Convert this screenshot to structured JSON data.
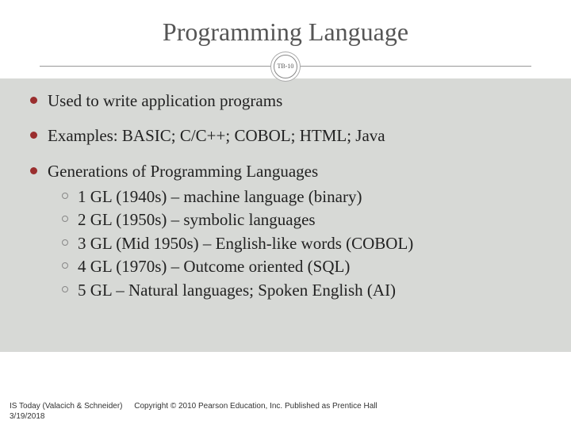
{
  "title": "Programming Language",
  "badge": "TB-10",
  "bullets": [
    {
      "text": "Used to write application programs"
    },
    {
      "text": "Examples: BASIC; C/C++; COBOL; HTML; Java"
    },
    {
      "text": "Generations of Programming Languages",
      "sub": [
        "1 GL (1940s) – machine language (binary)",
        "2 GL (1950s) – symbolic languages",
        "3 GL (Mid 1950s) – English-like words (COBOL)",
        "4 GL (1970s) – Outcome oriented (SQL)",
        "5 GL – Natural languages; Spoken English (AI)"
      ]
    }
  ],
  "footer": {
    "source": "IS Today (Valacich & Schneider)",
    "copyright": "Copyright © 2010 Pearson Education, Inc. Published as Prentice Hall",
    "date": "3/19/2018"
  }
}
